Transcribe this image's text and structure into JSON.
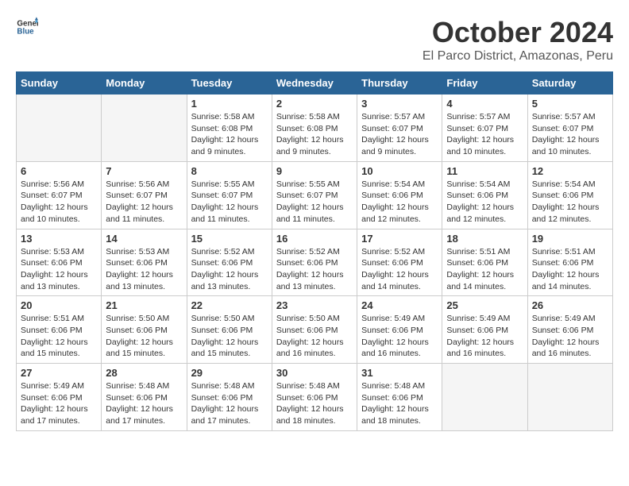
{
  "header": {
    "logo_general": "General",
    "logo_blue": "Blue",
    "month": "October 2024",
    "location": "El Parco District, Amazonas, Peru"
  },
  "days_of_week": [
    "Sunday",
    "Monday",
    "Tuesday",
    "Wednesday",
    "Thursday",
    "Friday",
    "Saturday"
  ],
  "weeks": [
    [
      {
        "day": "",
        "sunrise": "",
        "sunset": "",
        "daylight": "",
        "empty": true
      },
      {
        "day": "",
        "sunrise": "",
        "sunset": "",
        "daylight": "",
        "empty": true
      },
      {
        "day": "1",
        "sunrise": "Sunrise: 5:58 AM",
        "sunset": "Sunset: 6:08 PM",
        "daylight": "Daylight: 12 hours and 9 minutes.",
        "empty": false
      },
      {
        "day": "2",
        "sunrise": "Sunrise: 5:58 AM",
        "sunset": "Sunset: 6:08 PM",
        "daylight": "Daylight: 12 hours and 9 minutes.",
        "empty": false
      },
      {
        "day": "3",
        "sunrise": "Sunrise: 5:57 AM",
        "sunset": "Sunset: 6:07 PM",
        "daylight": "Daylight: 12 hours and 9 minutes.",
        "empty": false
      },
      {
        "day": "4",
        "sunrise": "Sunrise: 5:57 AM",
        "sunset": "Sunset: 6:07 PM",
        "daylight": "Daylight: 12 hours and 10 minutes.",
        "empty": false
      },
      {
        "day": "5",
        "sunrise": "Sunrise: 5:57 AM",
        "sunset": "Sunset: 6:07 PM",
        "daylight": "Daylight: 12 hours and 10 minutes.",
        "empty": false
      }
    ],
    [
      {
        "day": "6",
        "sunrise": "Sunrise: 5:56 AM",
        "sunset": "Sunset: 6:07 PM",
        "daylight": "Daylight: 12 hours and 10 minutes.",
        "empty": false
      },
      {
        "day": "7",
        "sunrise": "Sunrise: 5:56 AM",
        "sunset": "Sunset: 6:07 PM",
        "daylight": "Daylight: 12 hours and 11 minutes.",
        "empty": false
      },
      {
        "day": "8",
        "sunrise": "Sunrise: 5:55 AM",
        "sunset": "Sunset: 6:07 PM",
        "daylight": "Daylight: 12 hours and 11 minutes.",
        "empty": false
      },
      {
        "day": "9",
        "sunrise": "Sunrise: 5:55 AM",
        "sunset": "Sunset: 6:07 PM",
        "daylight": "Daylight: 12 hours and 11 minutes.",
        "empty": false
      },
      {
        "day": "10",
        "sunrise": "Sunrise: 5:54 AM",
        "sunset": "Sunset: 6:06 PM",
        "daylight": "Daylight: 12 hours and 12 minutes.",
        "empty": false
      },
      {
        "day": "11",
        "sunrise": "Sunrise: 5:54 AM",
        "sunset": "Sunset: 6:06 PM",
        "daylight": "Daylight: 12 hours and 12 minutes.",
        "empty": false
      },
      {
        "day": "12",
        "sunrise": "Sunrise: 5:54 AM",
        "sunset": "Sunset: 6:06 PM",
        "daylight": "Daylight: 12 hours and 12 minutes.",
        "empty": false
      }
    ],
    [
      {
        "day": "13",
        "sunrise": "Sunrise: 5:53 AM",
        "sunset": "Sunset: 6:06 PM",
        "daylight": "Daylight: 12 hours and 13 minutes.",
        "empty": false
      },
      {
        "day": "14",
        "sunrise": "Sunrise: 5:53 AM",
        "sunset": "Sunset: 6:06 PM",
        "daylight": "Daylight: 12 hours and 13 minutes.",
        "empty": false
      },
      {
        "day": "15",
        "sunrise": "Sunrise: 5:52 AM",
        "sunset": "Sunset: 6:06 PM",
        "daylight": "Daylight: 12 hours and 13 minutes.",
        "empty": false
      },
      {
        "day": "16",
        "sunrise": "Sunrise: 5:52 AM",
        "sunset": "Sunset: 6:06 PM",
        "daylight": "Daylight: 12 hours and 13 minutes.",
        "empty": false
      },
      {
        "day": "17",
        "sunrise": "Sunrise: 5:52 AM",
        "sunset": "Sunset: 6:06 PM",
        "daylight": "Daylight: 12 hours and 14 minutes.",
        "empty": false
      },
      {
        "day": "18",
        "sunrise": "Sunrise: 5:51 AM",
        "sunset": "Sunset: 6:06 PM",
        "daylight": "Daylight: 12 hours and 14 minutes.",
        "empty": false
      },
      {
        "day": "19",
        "sunrise": "Sunrise: 5:51 AM",
        "sunset": "Sunset: 6:06 PM",
        "daylight": "Daylight: 12 hours and 14 minutes.",
        "empty": false
      }
    ],
    [
      {
        "day": "20",
        "sunrise": "Sunrise: 5:51 AM",
        "sunset": "Sunset: 6:06 PM",
        "daylight": "Daylight: 12 hours and 15 minutes.",
        "empty": false
      },
      {
        "day": "21",
        "sunrise": "Sunrise: 5:50 AM",
        "sunset": "Sunset: 6:06 PM",
        "daylight": "Daylight: 12 hours and 15 minutes.",
        "empty": false
      },
      {
        "day": "22",
        "sunrise": "Sunrise: 5:50 AM",
        "sunset": "Sunset: 6:06 PM",
        "daylight": "Daylight: 12 hours and 15 minutes.",
        "empty": false
      },
      {
        "day": "23",
        "sunrise": "Sunrise: 5:50 AM",
        "sunset": "Sunset: 6:06 PM",
        "daylight": "Daylight: 12 hours and 16 minutes.",
        "empty": false
      },
      {
        "day": "24",
        "sunrise": "Sunrise: 5:49 AM",
        "sunset": "Sunset: 6:06 PM",
        "daylight": "Daylight: 12 hours and 16 minutes.",
        "empty": false
      },
      {
        "day": "25",
        "sunrise": "Sunrise: 5:49 AM",
        "sunset": "Sunset: 6:06 PM",
        "daylight": "Daylight: 12 hours and 16 minutes.",
        "empty": false
      },
      {
        "day": "26",
        "sunrise": "Sunrise: 5:49 AM",
        "sunset": "Sunset: 6:06 PM",
        "daylight": "Daylight: 12 hours and 16 minutes.",
        "empty": false
      }
    ],
    [
      {
        "day": "27",
        "sunrise": "Sunrise: 5:49 AM",
        "sunset": "Sunset: 6:06 PM",
        "daylight": "Daylight: 12 hours and 17 minutes.",
        "empty": false
      },
      {
        "day": "28",
        "sunrise": "Sunrise: 5:48 AM",
        "sunset": "Sunset: 6:06 PM",
        "daylight": "Daylight: 12 hours and 17 minutes.",
        "empty": false
      },
      {
        "day": "29",
        "sunrise": "Sunrise: 5:48 AM",
        "sunset": "Sunset: 6:06 PM",
        "daylight": "Daylight: 12 hours and 17 minutes.",
        "empty": false
      },
      {
        "day": "30",
        "sunrise": "Sunrise: 5:48 AM",
        "sunset": "Sunset: 6:06 PM",
        "daylight": "Daylight: 12 hours and 18 minutes.",
        "empty": false
      },
      {
        "day": "31",
        "sunrise": "Sunrise: 5:48 AM",
        "sunset": "Sunset: 6:06 PM",
        "daylight": "Daylight: 12 hours and 18 minutes.",
        "empty": false
      },
      {
        "day": "",
        "sunrise": "",
        "sunset": "",
        "daylight": "",
        "empty": true
      },
      {
        "day": "",
        "sunrise": "",
        "sunset": "",
        "daylight": "",
        "empty": true
      }
    ]
  ]
}
